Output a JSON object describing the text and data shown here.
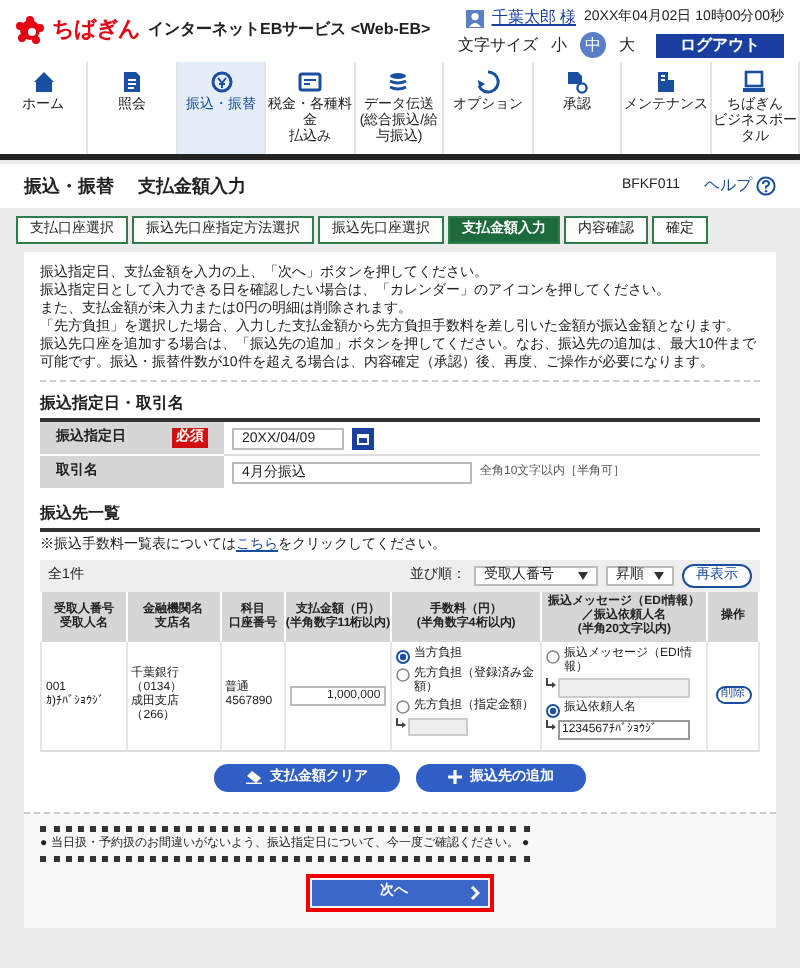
{
  "header": {
    "logo": "ちばぎん",
    "service": "インターネットEBサービス <Web-EB>",
    "user": "千葉太郎 様",
    "datetime": "20XX年04月02日 10時00分00秒",
    "font_size_label": "文字サイズ",
    "font_sizes": [
      {
        "label": "小",
        "selected": false
      },
      {
        "label": "中",
        "selected": true
      },
      {
        "label": "大",
        "selected": false
      }
    ],
    "logout": "ログアウト"
  },
  "nav": [
    {
      "lines": [
        "ホーム"
      ],
      "selected": false
    },
    {
      "lines": [
        "照会"
      ],
      "selected": false
    },
    {
      "lines": [
        "振込・振替"
      ],
      "selected": true
    },
    {
      "lines": [
        "税金・各種料金",
        "払込み"
      ],
      "selected": false
    },
    {
      "lines": [
        "データ伝送",
        "(総合振込/給与振込)"
      ],
      "selected": false
    },
    {
      "lines": [
        "オプション"
      ],
      "selected": false
    },
    {
      "lines": [
        "承認"
      ],
      "selected": false
    },
    {
      "lines": [
        "メンテナンス"
      ],
      "selected": false
    },
    {
      "lines": [
        "ちばぎん",
        "ビジネスポータル"
      ],
      "selected": false
    }
  ],
  "page_title": {
    "category": "振込・振替",
    "title": "支払金額入力",
    "screen_id": "BFKF011",
    "help": "ヘルプ"
  },
  "steps": [
    {
      "label": "支払口座選択",
      "selected": false
    },
    {
      "label": "振込先口座指定方法選択",
      "selected": false
    },
    {
      "label": "振込先口座選択",
      "selected": false
    },
    {
      "label": "支払金額入力",
      "selected": true
    },
    {
      "label": "内容確認",
      "selected": false
    },
    {
      "label": "確定",
      "selected": false
    }
  ],
  "instructions": [
    "振込指定日、支払金額を入力の上、「次へ」ボタンを押してください。",
    "振込指定日として入力できる日を確認したい場合は、「カレンダー」のアイコンを押してください。",
    "また、支払金額が未入力または0円の明細は削除されます。",
    "「先方負担」を選択した場合、入力した支払金額から先方負担手数料を差し引いた金額が振込金額となります。",
    "振込先口座を追加する場合は、「振込先の追加」ボタンを押してください。なお、振込先の追加は、最大10件まで可能です。振込・振替件数が10件を超える場合は、内容確定（承認）後、再度、ご操作が必要になります。"
  ],
  "date_section": {
    "title": "振込指定日・取引名",
    "date_label": "振込指定日",
    "required": "必須",
    "date_value": "20XX/04/09",
    "name_label": "取引名",
    "name_value": "4月分振込",
    "name_hint": "全角10文字以内［半角可］"
  },
  "payee_section": {
    "title": "振込先一覧",
    "note_before": "※振込手数料一覧表については",
    "note_link": "こちら",
    "note_after": "をクリックしてください。",
    "count": "全1件",
    "sort_label": "並び順：",
    "sort_key": "受取人番号",
    "sort_order": "昇順",
    "refresh": "再表示",
    "columns": [
      {
        "lines": [
          "受取人番号",
          "受取人名"
        ]
      },
      {
        "lines": [
          "金融機関名",
          "支店名"
        ]
      },
      {
        "lines": [
          "科目",
          "口座番号"
        ]
      },
      {
        "lines": [
          "支払金額（円）",
          "(半角数字11桁以内)"
        ]
      },
      {
        "lines": [
          "手数料（円）",
          "(半角数字4桁以内)"
        ]
      },
      {
        "lines": [
          "振込メッセージ（EDI情報）",
          "／振込依頼人名",
          "(半角20文字以内)"
        ]
      },
      {
        "lines": [
          "操作"
        ]
      }
    ],
    "rows": [
      {
        "payee_number": "001",
        "payee_name": "ｶ)ﾁﾊﾞｼｮｳｼﾞ",
        "bank": "千葉銀行（0134）",
        "branch": "成田支店（266）",
        "account_type": "普通",
        "account_number": "4567890",
        "amount": "1,000,000",
        "fee_options": [
          {
            "label": "当方負担",
            "selected": true
          },
          {
            "label": "先方負担（登録済み金額）",
            "selected": false
          },
          {
            "label": "先方負担（指定金額）",
            "selected": false
          }
        ],
        "message_options": [
          {
            "label": "振込メッセージ（EDI情報）",
            "selected": false
          },
          {
            "label": "振込依頼人名",
            "selected": true,
            "value": "1234567ﾁﾊﾞｼｮｳｼﾞ"
          }
        ],
        "delete": "削除"
      }
    ],
    "clear_button": "支払金額クリア",
    "add_button": "振込先の追加"
  },
  "notice": "● 当日扱・予約扱のお間違いがないよう、振込指定日について、今一度ご確認ください。 ●",
  "next_button": "次へ"
}
